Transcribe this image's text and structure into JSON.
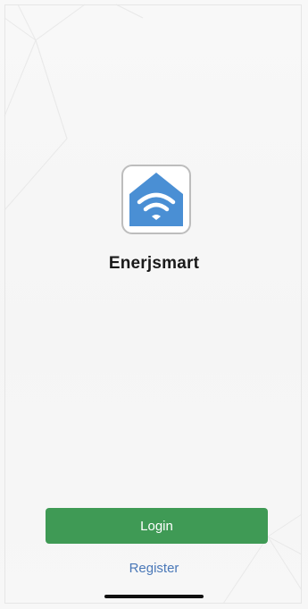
{
  "app": {
    "name": "Enerjsmart",
    "icon": "house-wifi-icon"
  },
  "actions": {
    "login_label": "Login",
    "register_label": "Register"
  },
  "colors": {
    "primary_green": "#3f9a55",
    "link_blue": "#4a78b8",
    "icon_blue": "#4a8fd4",
    "background": "#f6f6f6"
  }
}
